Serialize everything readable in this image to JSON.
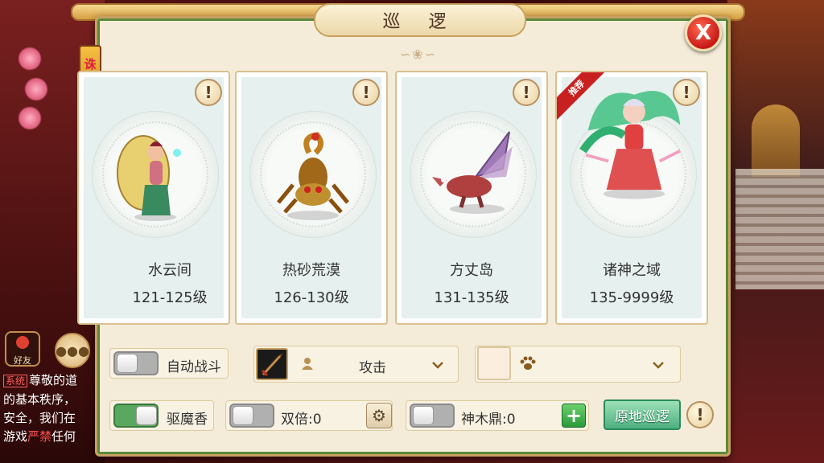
{
  "title": "巡 逻",
  "side_banner": "诛仙趣变",
  "close_label": "X",
  "left_ui": {
    "friends_label": "好友",
    "chat": {
      "system_tag": "系统",
      "line1": "尊敬的道",
      "line2": "的基本秩序，",
      "line3": "安全，我们在",
      "line4_a": "游戏",
      "line4_red": "严禁",
      "line4_b": "任何"
    }
  },
  "recommend_label": "推荐",
  "cards": [
    {
      "name": "水云间",
      "level": "121-125级",
      "recommended": false
    },
    {
      "name": "热砂荒漠",
      "level": "126-130级",
      "recommended": false
    },
    {
      "name": "方丈岛",
      "level": "131-135级",
      "recommended": false
    },
    {
      "name": "诸神之域",
      "level": "135-9999级",
      "recommended": true
    }
  ],
  "controls": {
    "auto_battle": {
      "label": "自动战斗",
      "on": false
    },
    "skill_select": {
      "value": "攻击"
    },
    "pet_select": {
      "value": ""
    },
    "repel_incense": {
      "label": "驱魔香",
      "on": true
    },
    "double": {
      "label": "双倍:0",
      "on": false
    },
    "divine_tripod": {
      "label": "神木鼎:0",
      "on": false
    },
    "patrol_button": "原地巡逻"
  },
  "colors": {
    "panel_bg": "#f4ecd8",
    "accent_gold": "#c8a060",
    "toggle_on": "#5aa860",
    "close_red": "#c81818"
  }
}
